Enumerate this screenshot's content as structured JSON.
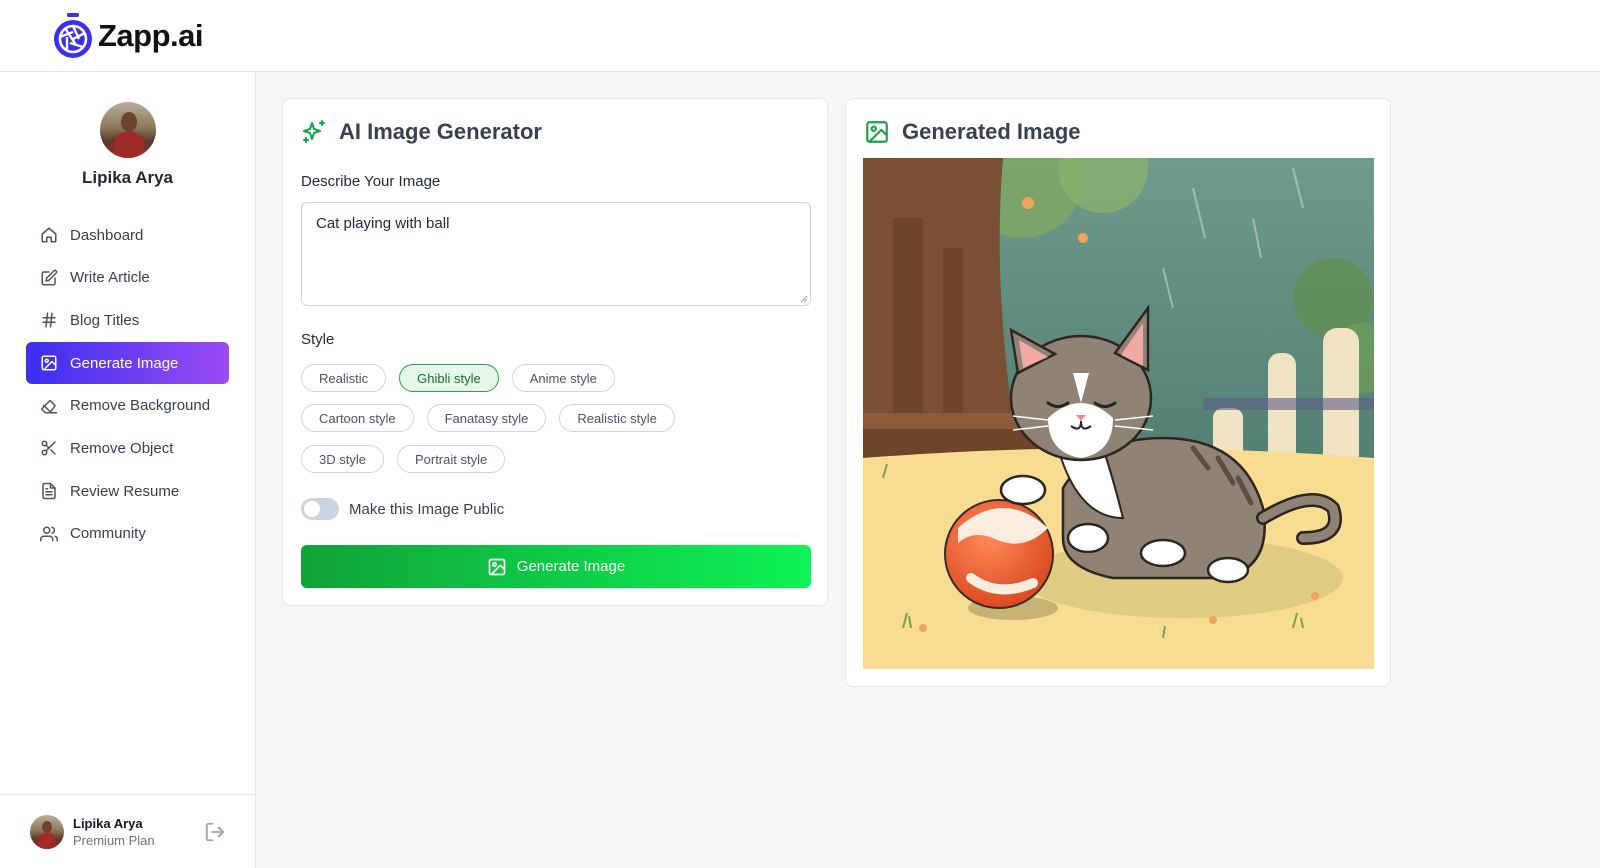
{
  "app": {
    "name": "Zapp.ai",
    "logo_icon": "camera-aperture-icon"
  },
  "user": {
    "name": "Lipika Arya",
    "plan": "Premium Plan"
  },
  "sidebar": {
    "items": [
      {
        "label": "Dashboard",
        "icon": "home-icon"
      },
      {
        "label": "Write Article",
        "icon": "edit-icon"
      },
      {
        "label": "Blog Titles",
        "icon": "hash-icon"
      },
      {
        "label": "Generate Image",
        "icon": "image-icon",
        "active": true
      },
      {
        "label": "Remove Background",
        "icon": "eraser-icon"
      },
      {
        "label": "Remove Object",
        "icon": "scissors-icon"
      },
      {
        "label": "Review Resume",
        "icon": "file-text-icon"
      },
      {
        "label": "Community",
        "icon": "users-icon"
      }
    ]
  },
  "generator": {
    "title": "AI Image Generator",
    "prompt_label": "Describe Your Image",
    "prompt_value": "Cat playing with ball",
    "style_label": "Style",
    "styles": [
      [
        "Realistic",
        "Ghibli style",
        "Anime style"
      ],
      [
        "Cartoon style",
        "Fanatasy style",
        "Realistic style"
      ],
      [
        "3D style",
        "Portrait style"
      ]
    ],
    "selected_style": "Ghibli style",
    "public_toggle_label": "Make this Image Public",
    "public_toggle_on": false,
    "button_label": "Generate Image"
  },
  "result": {
    "title": "Generated Image"
  },
  "colors": {
    "accent_purple_start": "#3b2ff0",
    "accent_purple_end": "#9b4cf5",
    "green_start": "#0fa336",
    "green_end": "#0ef356",
    "icon_green": "#16a34a"
  }
}
